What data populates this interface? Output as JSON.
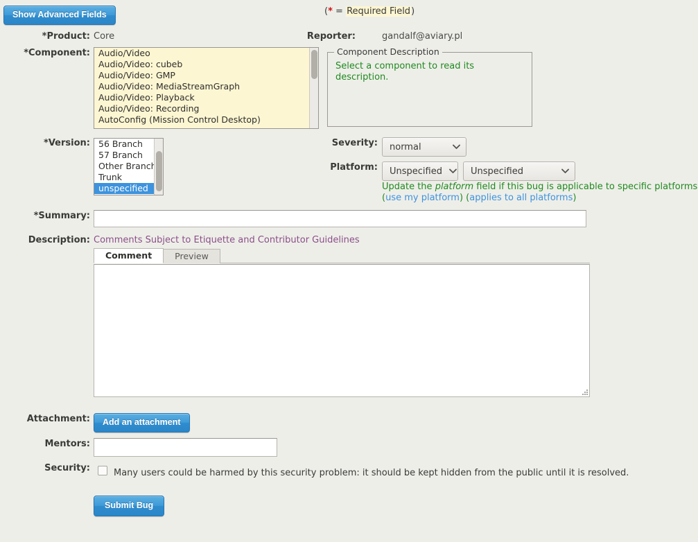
{
  "toolbar": {
    "show_advanced_label": "Show Advanced Fields",
    "required_note_prefix": "(",
    "required_note_star": "*",
    "required_note_eq": " = ",
    "required_note_text": "Required Field",
    "required_note_suffix": ")"
  },
  "fields": {
    "product": {
      "label": "Product:",
      "value": "Core",
      "required": true
    },
    "component": {
      "label": "Component:",
      "required": true,
      "options": [
        "Audio/Video",
        "Audio/Video: cubeb",
        "Audio/Video: GMP",
        "Audio/Video: MediaStreamGraph",
        "Audio/Video: Playback",
        "Audio/Video: Recording",
        "AutoConfig (Mission Control Desktop)"
      ],
      "selected": null
    },
    "reporter": {
      "label": "Reporter:",
      "value": "gandalf@aviary.pl"
    },
    "component_description": {
      "legend": "Component Description",
      "text": "Select a component to read its description."
    },
    "version": {
      "label": "Version:",
      "required": true,
      "options": [
        "56 Branch",
        "57 Branch",
        "Other Branch",
        "Trunk",
        "unspecified"
      ],
      "selected": "unspecified"
    },
    "severity": {
      "label": "Severity:",
      "value": "normal"
    },
    "platform": {
      "label": "Platform:",
      "hardware_value": "Unspecified",
      "os_value": "Unspecified",
      "hint_part1": "Update the ",
      "hint_em": "platform",
      "hint_part2": " field if this bug is applicable to specific platforms.",
      "link_use_my_platform": "use my platform",
      "link_applies_all": "applies to all platforms"
    },
    "summary": {
      "label": "Summary:",
      "required": true,
      "value": "",
      "placeholder": ""
    },
    "description": {
      "label": "Description:",
      "guidelines_link": "Comments Subject to Etiquette and Contributor Guidelines",
      "tabs": [
        {
          "label": "Comment",
          "active": true
        },
        {
          "label": "Preview",
          "active": false
        }
      ],
      "comment_value": "",
      "comment_placeholder": ""
    },
    "attachment": {
      "label": "Attachment:",
      "button_label": "Add an attachment"
    },
    "mentors": {
      "label": "Mentors:",
      "value": "",
      "placeholder": ""
    },
    "security": {
      "label": "Security:",
      "checkbox_checked": false,
      "checkbox_text": "Many users could be harmed by this security problem: it should be kept hidden from the public until it is resolved."
    },
    "submit": {
      "label": "Submit Bug"
    }
  },
  "colors": {
    "page_bg": "#eeeee9",
    "required_highlight": "#fdf6d2",
    "required_star": "#d01111",
    "accent_blue": "#3d93dd",
    "hint_green": "#1f8a1f",
    "visited_link": "#8a4f87",
    "selection_blue": "#3d93dd"
  }
}
